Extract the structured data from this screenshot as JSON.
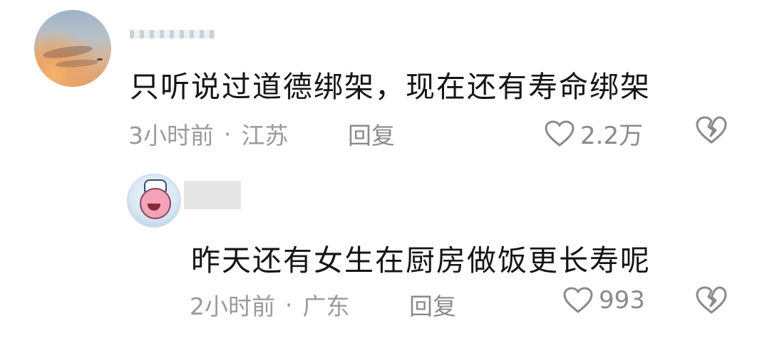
{
  "comments": [
    {
      "text": "只听说过道德绑架，现在还有寿命绑架",
      "time": "3小时前",
      "separator": "·",
      "location": "江苏",
      "reply_label": "回复",
      "likes": "2.2万",
      "avatar_icon": "sunset-avatar"
    },
    {
      "text": "昨天还有女生在厨房做饭更长寿呢",
      "time": "2小时前",
      "separator": "·",
      "location": "广东",
      "reply_label": "回复",
      "likes": "993",
      "avatar_icon": "patrick-star-avatar"
    }
  ],
  "icons": {
    "like": "heart-outline-icon",
    "dislike": "broken-heart-icon"
  },
  "colors": {
    "text": "#151515",
    "meta": "#9a9a9a",
    "icon": "#8a8a8a"
  }
}
